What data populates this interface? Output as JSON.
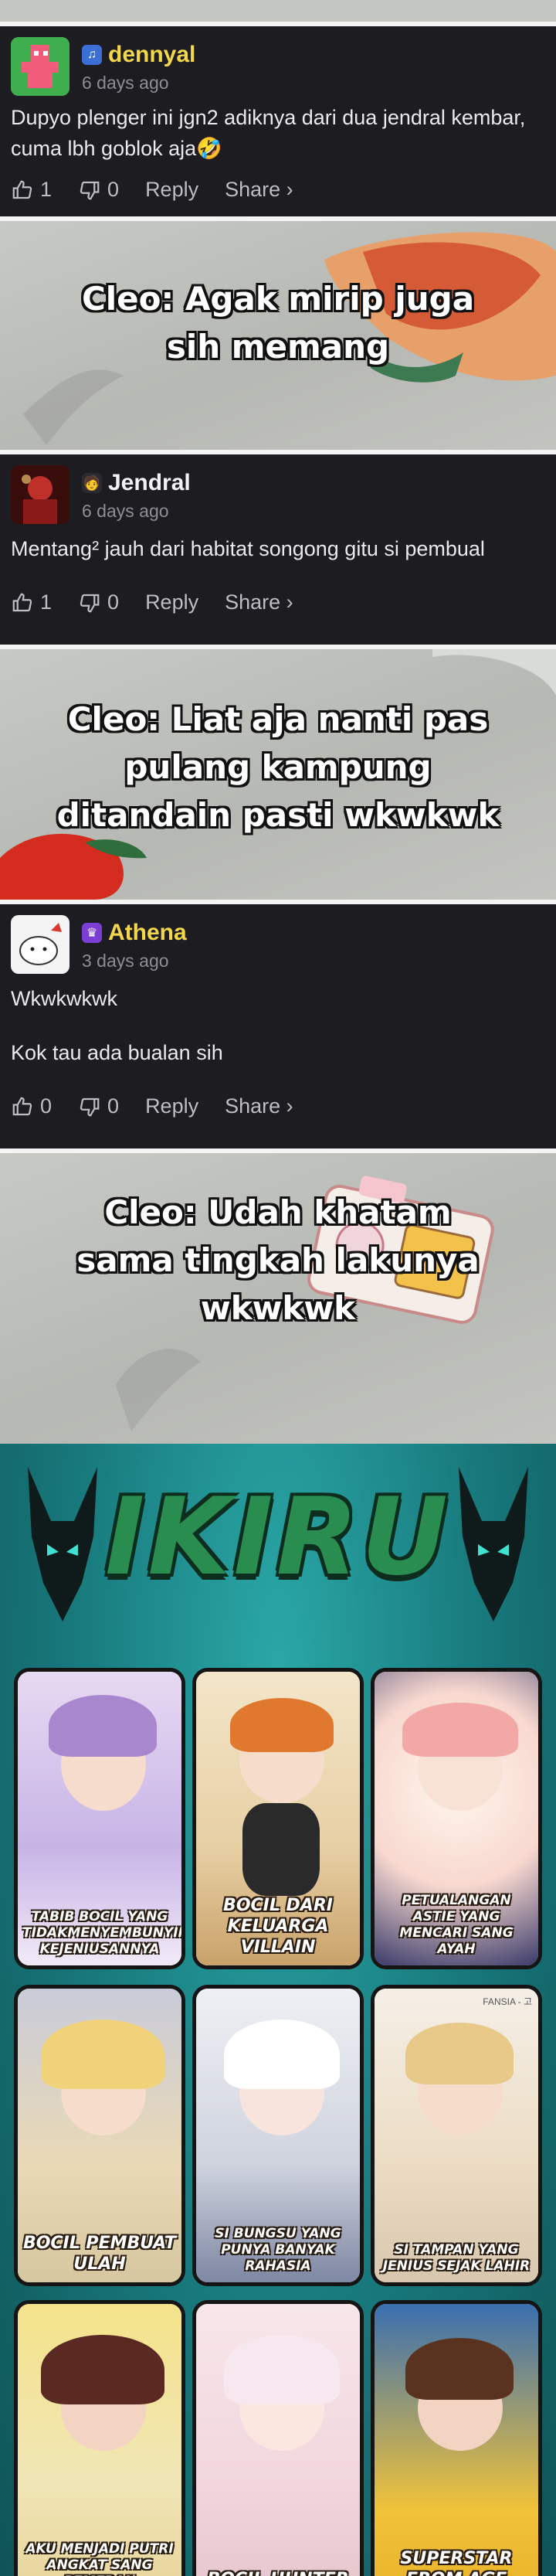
{
  "comments": [
    {
      "username": "dennyal",
      "badge_icon": "music-note-icon",
      "time_ago": "6 days ago",
      "body": [
        "Dupyo plenger ini jgn2 adiknya dari dua jendral kembar, cuma lbh goblok aja🤣"
      ],
      "likes": "1",
      "dislikes": "0",
      "reply_label": "Reply",
      "share_label": "Share ›"
    },
    {
      "username": "Jendral",
      "badge_icon": "person-icon",
      "time_ago": "6 days ago",
      "body": [
        "Mentang² jauh dari habitat songong gitu si pembual"
      ],
      "likes": "1",
      "dislikes": "0",
      "reply_label": "Reply",
      "share_label": "Share ›"
    },
    {
      "username": "Athena",
      "badge_icon": "crown-icon",
      "time_ago": "3 days ago",
      "body": [
        "Wkwkwkwk",
        "Kok tau ada bualan sih"
      ],
      "likes": "0",
      "dislikes": "0",
      "reply_label": "Reply",
      "share_label": "Share ›"
    }
  ],
  "panels": [
    {
      "caption": "Cleo: Agak mirip juga sih memang"
    },
    {
      "caption": "Cleo: Liat aja nanti pas pulang kampung ditandain pasti wkwkwk"
    },
    {
      "caption": "Cleo: Udah khatam sama tingkah lakunya wkwkwk"
    }
  ],
  "promo": {
    "logo_text": "IKIRU",
    "watermark": "FANSIA - 고",
    "cards": [
      {
        "title": "TABIB BOCIL YANG TIDAKMENYEMBUNYIKAN KEJENIUSANNYA"
      },
      {
        "title": "BOCIL DARI KELUARGA VILLAIN"
      },
      {
        "title": "PETUALANGAN ASTIE YANG MENCARI SANG AYAH"
      },
      {
        "title": "BOCIL PEMBUAT ULAH"
      },
      {
        "title": "SI BUNGSU YANG PUNYA BANYAK RAHASIA"
      },
      {
        "title": "SI TAMPAN YANG JENIUS SEJAK LAHIR"
      },
      {
        "title": "AKU MENJADI PUTRI ANGKAT SANG PEMERAN"
      },
      {
        "title": "BOCIL HUNTER"
      },
      {
        "title": "SUPERSTAR FROM AGE"
      }
    ]
  },
  "colors": {
    "username_accent": "#f3d74a",
    "card_bg": "#1c1c21",
    "promo_teal": "#17777a",
    "logo_green": "#2a8d50"
  }
}
